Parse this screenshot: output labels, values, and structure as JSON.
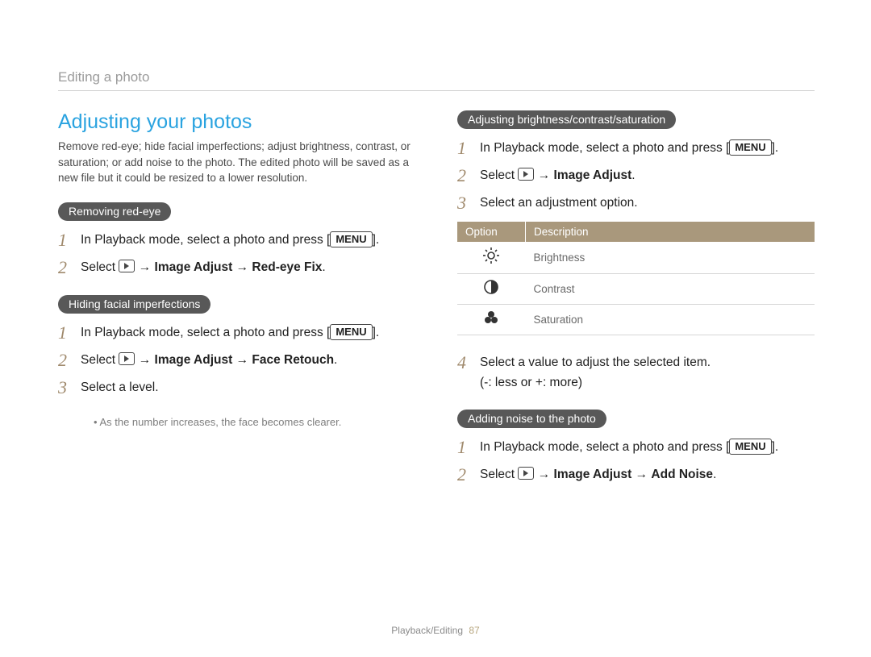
{
  "breadcrumb": "Editing a photo",
  "title": "Adjusting your photos",
  "intro": "Remove red-eye; hide facial imperfections; adjust brightness, contrast, or saturation; or add noise to the photo. The edited photo will be saved as a new file but it could be resized to a lower resolution.",
  "labels": {
    "menu": "MENU",
    "arrow": "→",
    "select": "Select",
    "image_adjust": "Image Adjust",
    "red_eye_fix": "Red-eye Fix",
    "face_retouch": "Face Retouch",
    "add_noise": "Add Noise"
  },
  "sections": {
    "redeye": {
      "heading": "Removing red-eye",
      "step1": "In Playback mode, select a photo and press [",
      "step1_end": "]."
    },
    "facial": {
      "heading": "Hiding facial imperfections",
      "step1": "In Playback mode, select a photo and press [",
      "step1_end": "].",
      "step3": "Select a level.",
      "note": "As the number increases, the face becomes clearer."
    },
    "bcs": {
      "heading": "Adjusting brightness/contrast/saturation",
      "step1": "In Playback mode, select a photo and press [",
      "step1_end": "].",
      "step3": "Select an adjustment option.",
      "step4": "Select a value to adjust the selected item.",
      "step4b": "(-: less or +: more)",
      "table": {
        "h_option": "Option",
        "h_desc": "Description",
        "rows": [
          {
            "icon": "brightness",
            "label": "Brightness"
          },
          {
            "icon": "contrast",
            "label": "Contrast"
          },
          {
            "icon": "saturation",
            "label": "Saturation"
          }
        ]
      }
    },
    "noise": {
      "heading": "Adding noise to the photo",
      "step1": "In Playback mode, select a photo and press [",
      "step1_end": "]."
    }
  },
  "footer": {
    "section": "Playback/Editing",
    "page": "87"
  }
}
